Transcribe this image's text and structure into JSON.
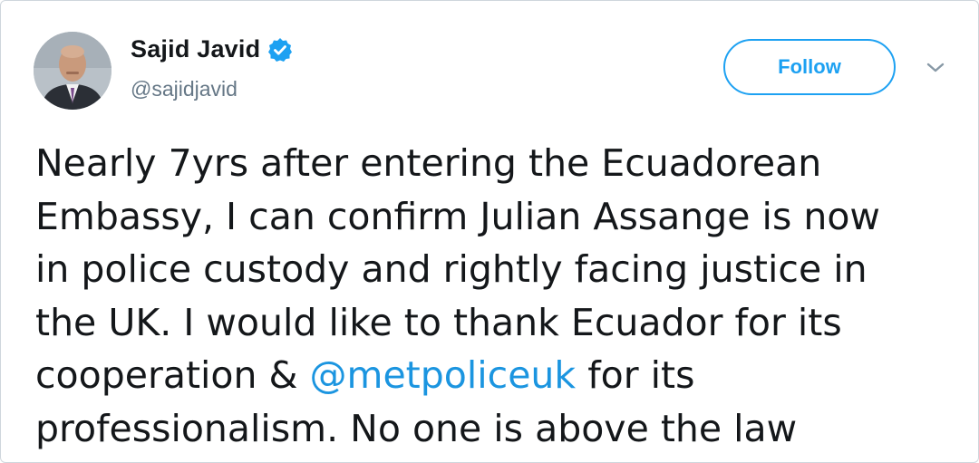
{
  "author": {
    "display_name": "Sajid Javid",
    "handle": "@sajidjavid",
    "verified": true
  },
  "follow_button_label": "Follow",
  "menu_icon": "chevron-down-icon",
  "accent_color": "#1da1f2",
  "tweet": {
    "line1": "Nearly 7yrs after entering the Ecuadorean",
    "line2": "Embassy, I can confirm Julian Assange is now",
    "line3": "in police custody and rightly facing justice in",
    "line4": "the UK. I would like to thank Ecuador for its",
    "line5_before": "cooperation & ",
    "line5_mention": "@metpoliceuk",
    "line5_after": " for its",
    "line6": "professionalism. No one is above the law"
  }
}
